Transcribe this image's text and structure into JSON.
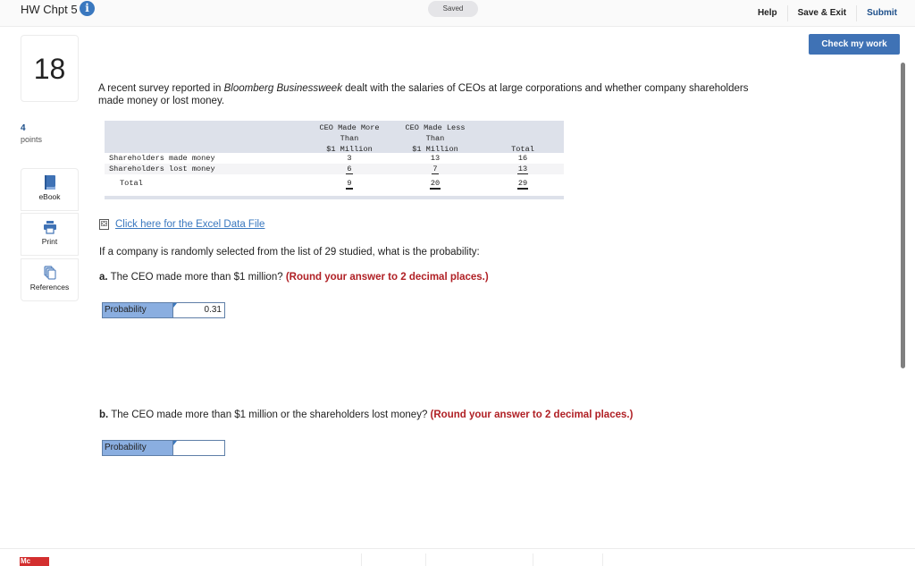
{
  "header": {
    "title": "HW Chpt 5",
    "info_icon": "info-icon",
    "saved_status": "Saved",
    "links": [
      "Help",
      "Save & Exit",
      "Submit"
    ],
    "check_button": "Check my work"
  },
  "sidebar": {
    "question_number": "18",
    "points_value": "4",
    "points_label": "points",
    "tools": [
      {
        "label": "eBook",
        "icon": "book-icon"
      },
      {
        "label": "Print",
        "icon": "printer-icon"
      },
      {
        "label": "References",
        "icon": "references-icon"
      }
    ]
  },
  "question": {
    "intro_before": "A recent survey reported in ",
    "intro_source": "Bloomberg Businessweek",
    "intro_after": " dealt with the salaries of CEOs at large corporations and whether company shareholders made money or lost money.",
    "table": {
      "headers": [
        [
          "CEO Made More",
          "Than",
          "$1 Million"
        ],
        [
          "CEO Made Less",
          "Than",
          "$1 Million"
        ],
        [
          "Total"
        ]
      ],
      "rows": [
        {
          "label": "Shareholders made money",
          "values": [
            "3",
            "13",
            "16"
          ]
        },
        {
          "label": "Shareholders lost money",
          "values": [
            "6",
            "7",
            "13"
          ]
        },
        {
          "label": "Total",
          "values": [
            "9",
            "20",
            "29"
          ]
        }
      ]
    },
    "excel_link": "Click here for the Excel Data File",
    "prompt": "If a company is randomly selected from the list of 29 studied, what is the probability:",
    "part_a": {
      "letter": "a.",
      "text": " The CEO made more than $1 million? ",
      "instruction": "(Round your answer to 2 decimal places.)",
      "field_label": "Probability",
      "value": "0.31"
    },
    "part_b": {
      "letter": "b.",
      "text": " The CEO made more than $1 million or the shareholders lost money? ",
      "instruction": "(Round your answer to 2 decimal places.)",
      "field_label": "Probability",
      "value": ""
    }
  },
  "footer": {
    "logo_text": "Mc"
  }
}
